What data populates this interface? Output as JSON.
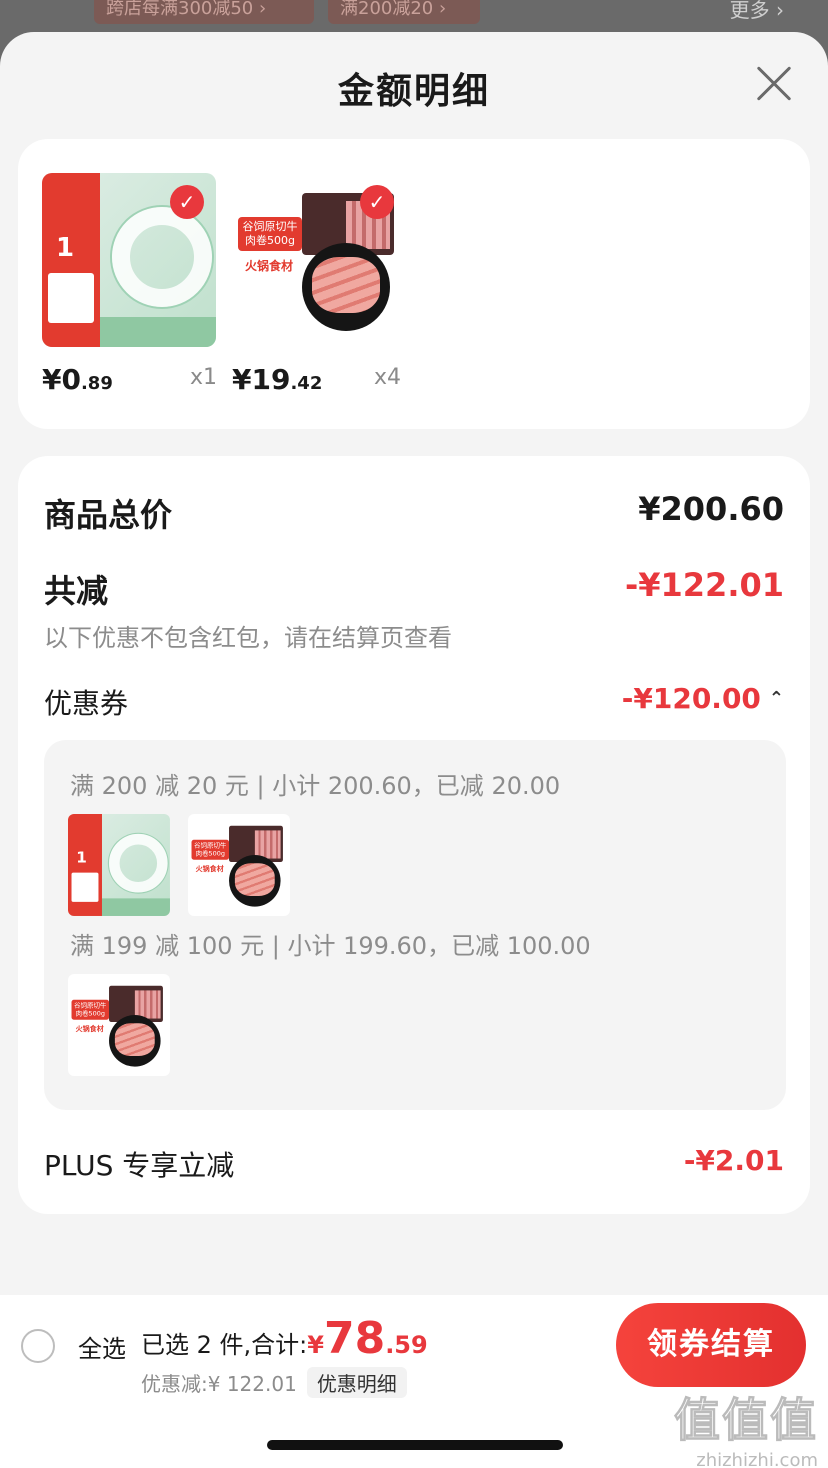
{
  "background": {
    "tags": [
      "跨店每满300减50 ›",
      "满200减20 ›"
    ],
    "more": "更多 ›"
  },
  "sheet": {
    "title": "金额明细",
    "close_icon": "close-icon"
  },
  "products": [
    {
      "name": "tape",
      "price_yen": "¥0",
      "price_dec": ".89",
      "qty": "x1",
      "checked": true,
      "art": {
        "promo_num": "1"
      }
    },
    {
      "name": "beef",
      "price_yen": "¥19",
      "price_dec": ".42",
      "qty": "x4",
      "checked": true,
      "art": {
        "label": "谷饲原切牛肉卷500g",
        "label2": "火锅食材"
      }
    }
  ],
  "breakdown": {
    "goods_total_label": "商品总价",
    "goods_total_value": "¥200.60",
    "reduce_label": "共减",
    "reduce_value": "-¥122.01",
    "reduce_note": "以下优惠不包含红包，请在结算页查看",
    "coupon_label": "优惠券",
    "coupon_value": "-¥120.00",
    "coupons": [
      {
        "text": "满 200 减 20 元 | 小计 200.60，已减 20.00"
      },
      {
        "text": "满 199 减 100 元 | 小计 199.60，已减 100.00"
      }
    ],
    "plus_label": "PLUS 专享立减",
    "plus_value": "-¥2.01"
  },
  "bottom_bar": {
    "select_all": "全选",
    "selected_text": "已选 2 件,合计:",
    "total_yen": "¥",
    "total_int": "78",
    "total_dec": ".59",
    "discount_text": "优惠减:¥ 122.01",
    "detail_link": "优惠明细",
    "checkout": "领券结算"
  },
  "watermark": {
    "big": "值值值",
    "small": "zhizhizhi.com"
  },
  "colors": {
    "accent": "#e8383d",
    "muted": "#8c8c8c"
  }
}
